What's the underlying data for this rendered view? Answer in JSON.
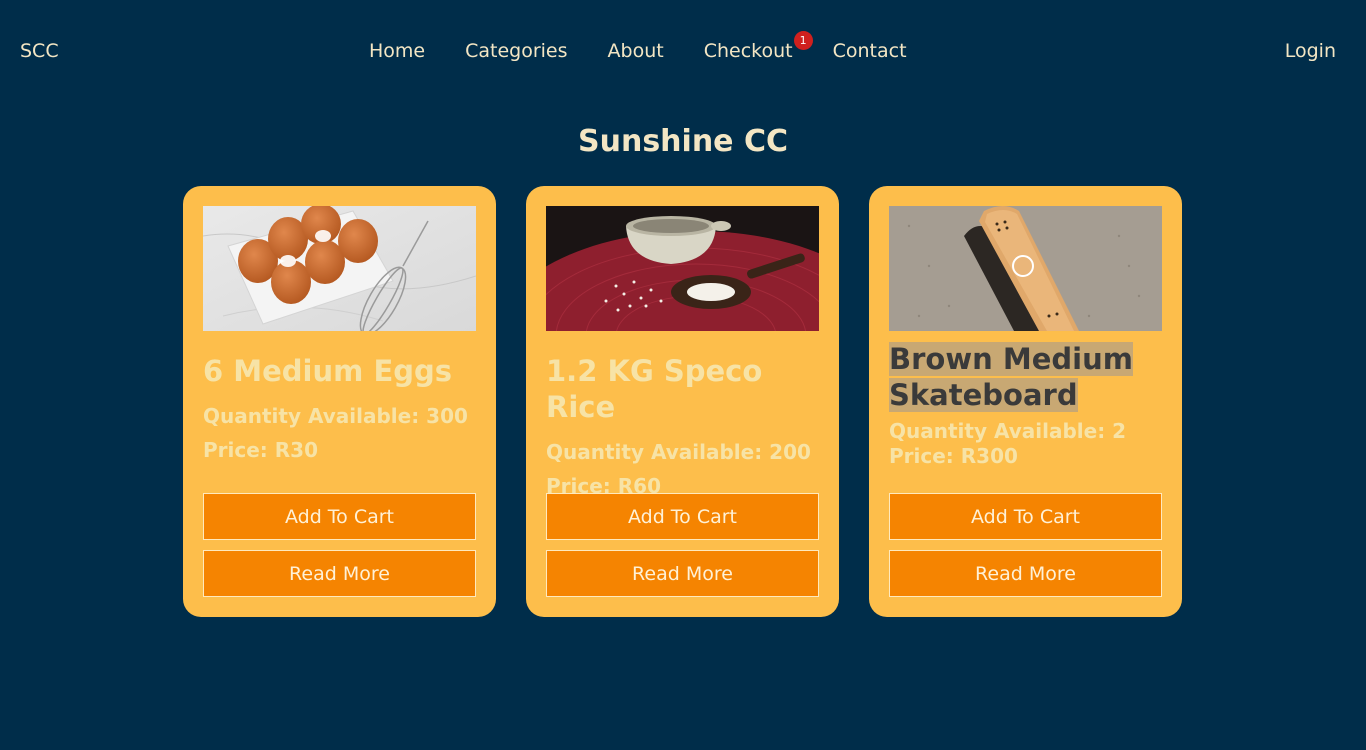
{
  "nav": {
    "brand": "SCC",
    "links": [
      {
        "label": "Home"
      },
      {
        "label": "Categories"
      },
      {
        "label": "About"
      },
      {
        "label": "Checkout",
        "badge": "1"
      },
      {
        "label": "Contact"
      }
    ],
    "login": "Login"
  },
  "page": {
    "title": "Sunshine CC"
  },
  "products": [
    {
      "image_icon": "eggs-photo",
      "name": "6 Medium Eggs",
      "quantity_text": "Quantity Available: 300",
      "price_text": "Price: R30",
      "add_label": "Add To Cart",
      "more_label": "Read More"
    },
    {
      "image_icon": "rice-photo",
      "name": "1.2 KG Speco Rice",
      "quantity_text": "Quantity Available: 200",
      "price_text": "Price: R60",
      "add_label": "Add To Cart",
      "more_label": "Read More"
    },
    {
      "image_icon": "skateboard-photo",
      "name": "Brown Medium Skateboard",
      "quantity_text": "Quantity Available: 2",
      "price_text": "Price: R300",
      "add_label": "Add To Cart",
      "more_label": "Read More"
    }
  ],
  "colors": {
    "background": "#002d4a",
    "card": "#fdbe4b",
    "button": "#f58401",
    "text": "#f3e6c4",
    "badge": "#d0201e"
  }
}
